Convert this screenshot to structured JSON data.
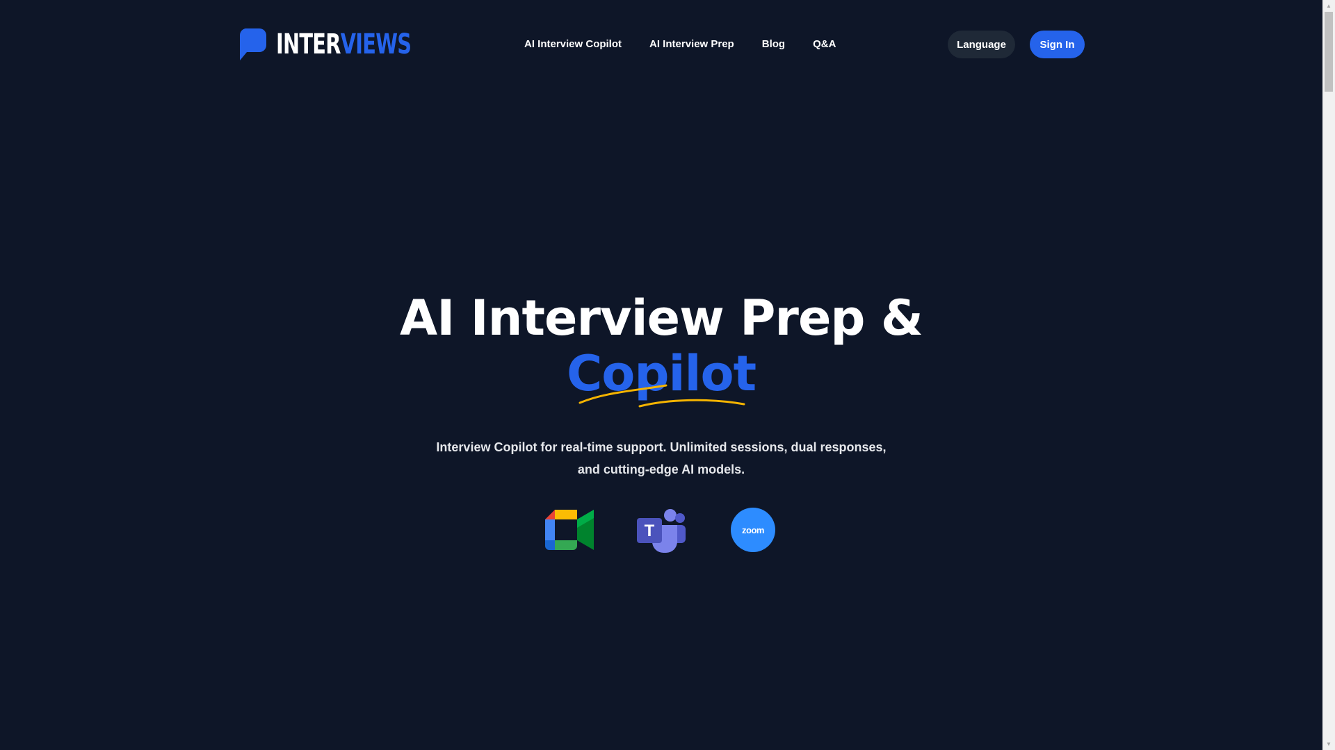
{
  "brand": {
    "name_part_a": "INTER",
    "name_part_b": "VIEWS",
    "accent_color": "#2563eb"
  },
  "nav": {
    "items": [
      {
        "label": "AI Interview Copilot"
      },
      {
        "label": "AI Interview Prep"
      },
      {
        "label": "Blog"
      },
      {
        "label": "Q&A"
      }
    ]
  },
  "header_actions": {
    "language_label": "Language",
    "signin_label": "Sign In"
  },
  "hero": {
    "title_line1": "AI Interview Prep &",
    "title_line2": "Copilot",
    "subtitle_line1": "Interview Copilot for real-time support. Unlimited sessions, dual responses,",
    "subtitle_line2": "and cutting-edge AI models."
  },
  "platforms": {
    "icons": [
      "google-meet-icon",
      "microsoft-teams-icon",
      "zoom-icon"
    ],
    "zoom_label": "zoom"
  },
  "colors": {
    "background": "#0e1628",
    "primary": "#2563eb",
    "underline": "#f5b400",
    "language_button": "#1f2937"
  }
}
